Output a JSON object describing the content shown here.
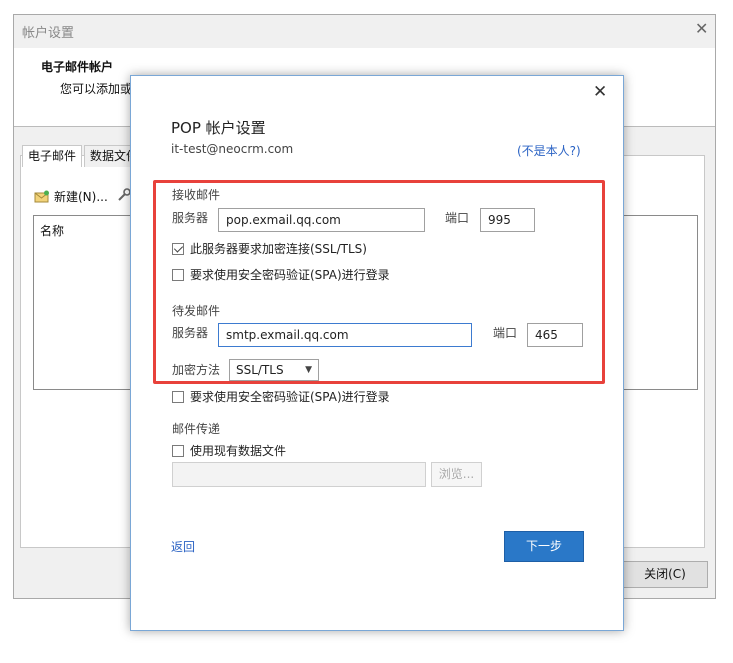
{
  "background_window": {
    "title": "帐户设置",
    "heading": "电子邮件帐户",
    "description": "您可以添加或",
    "tabs": [
      "电子邮件",
      "数据文件"
    ],
    "new_button": "新建(N)...",
    "list_header": "名称",
    "close_button": "关闭(C)"
  },
  "dialog": {
    "title": "POP 帐户设置",
    "account_email": "it-test@neocrm.com",
    "not_me_link": "(不是本人?)",
    "incoming": {
      "section_label": "接收邮件",
      "server_label": "服务器",
      "server_value": "pop.exmail.qq.com",
      "port_label": "端口",
      "port_value": "995",
      "ssl_checkbox_label": "此服务器要求加密连接(SSL/TLS)",
      "ssl_checked": true,
      "spa_checkbox_label": "要求使用安全密码验证(SPA)进行登录",
      "spa_checked": false
    },
    "outgoing": {
      "section_label": "待发邮件",
      "server_label": "服务器",
      "server_value": "smtp.exmail.qq.com",
      "port_label": "端口",
      "port_value": "465",
      "encryption_label": "加密方法",
      "encryption_value": "SSL/TLS",
      "spa_checkbox_label": "要求使用安全密码验证(SPA)进行登录",
      "spa_checked": false
    },
    "delivery": {
      "section_label": "邮件传递",
      "existing_file_label": "使用现有数据文件",
      "existing_file_checked": false,
      "path_value": "",
      "browse_button": "浏览..."
    },
    "back_link": "返回",
    "next_button": "下一步"
  },
  "colors": {
    "highlight_border": "#e8413b",
    "primary_button": "#2a78c8",
    "link": "#2b63c4"
  }
}
